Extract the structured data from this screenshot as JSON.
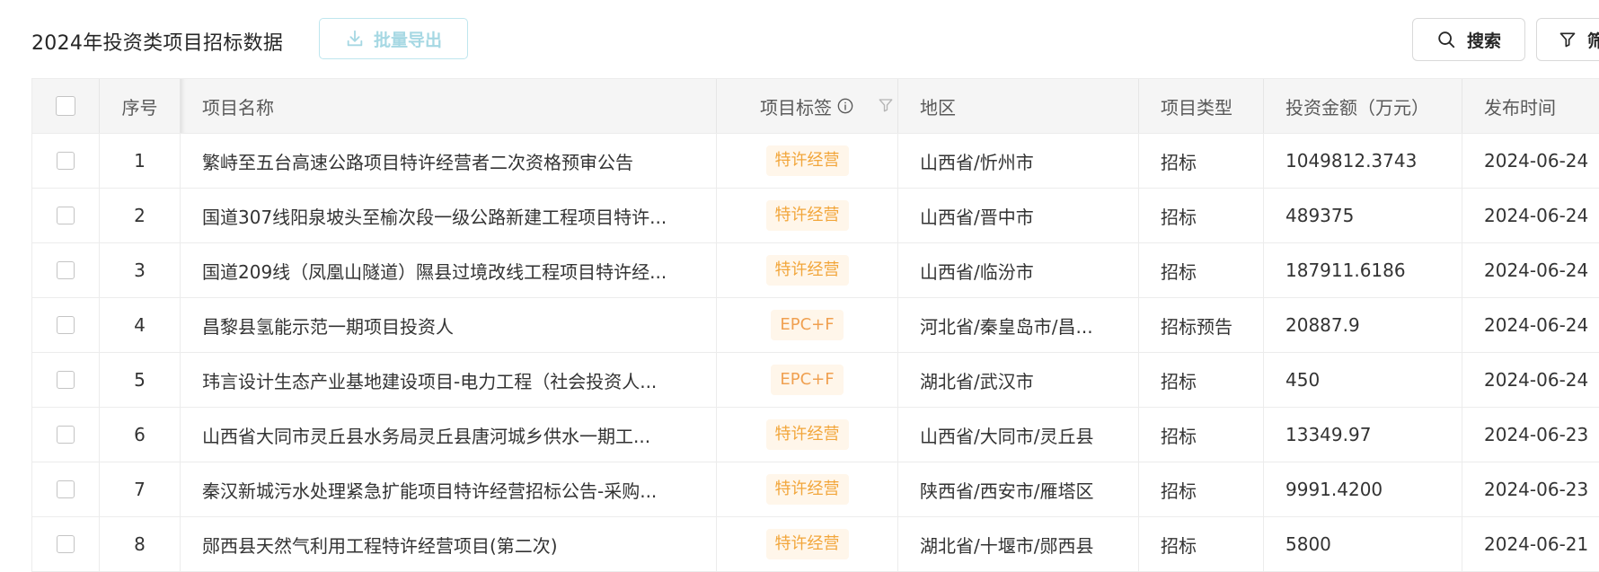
{
  "toolbar": {
    "title": "2024年投资类项目招标数据",
    "export_label": "批量导出",
    "search_label": "搜索",
    "filter_label": "筛"
  },
  "colors": {
    "export_tint": "#a6d8e3",
    "tag_bg": "#fff6ea",
    "tag_text": "#f2a63b",
    "header_bg": "#f5f5f5"
  },
  "table": {
    "columns": {
      "index": "序号",
      "name": "项目名称",
      "tag": "项目标签",
      "region": "地区",
      "type": "项目类型",
      "amount": "投资金额（万元）",
      "date": "发布时间"
    },
    "rows": [
      {
        "index": "1",
        "name": "繁峙至五台高速公路项目特许经营者二次资格预审公告",
        "tag": "特许经营",
        "region": "山西省/忻州市",
        "type": "招标",
        "amount": "1049812.3743",
        "date": "2024-06-24"
      },
      {
        "index": "2",
        "name": "国道307线阳泉坡头至榆次段一级公路新建工程项目特许...",
        "tag": "特许经营",
        "region": "山西省/晋中市",
        "type": "招标",
        "amount": "489375",
        "date": "2024-06-24"
      },
      {
        "index": "3",
        "name": "国道209线（凤凰山隧道）隰县过境改线工程项目特许经...",
        "tag": "特许经营",
        "region": "山西省/临汾市",
        "type": "招标",
        "amount": "187911.6186",
        "date": "2024-06-24"
      },
      {
        "index": "4",
        "name": "昌黎县氢能示范一期项目投资人",
        "tag": "EPC+F",
        "region": "河北省/秦皇岛市/昌...",
        "type": "招标预告",
        "amount": "20887.9",
        "date": "2024-06-24"
      },
      {
        "index": "5",
        "name": "玮言设计生态产业基地建设项目-电力工程（社会投资人...",
        "tag": "EPC+F",
        "region": "湖北省/武汉市",
        "type": "招标",
        "amount": "450",
        "date": "2024-06-24"
      },
      {
        "index": "6",
        "name": "山西省大同市灵丘县水务局灵丘县唐河城乡供水一期工...",
        "tag": "特许经营",
        "region": "山西省/大同市/灵丘县",
        "type": "招标",
        "amount": "13349.97",
        "date": "2024-06-23"
      },
      {
        "index": "7",
        "name": "秦汉新城污水处理紧急扩能项目特许经营招标公告-采购...",
        "tag": "特许经营",
        "region": "陕西省/西安市/雁塔区",
        "type": "招标",
        "amount": "9991.4200",
        "date": "2024-06-23"
      },
      {
        "index": "8",
        "name": "郧西县天然气利用工程特许经营项目(第二次)",
        "tag": "特许经营",
        "region": "湖北省/十堰市/郧西县",
        "type": "招标",
        "amount": "5800",
        "date": "2024-06-21"
      }
    ]
  }
}
